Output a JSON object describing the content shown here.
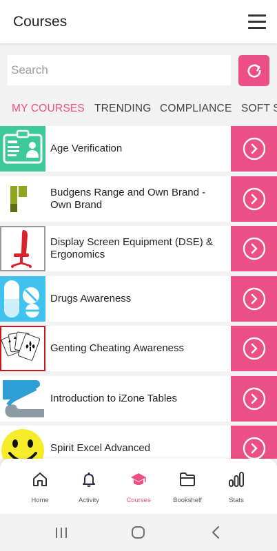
{
  "header": {
    "title": "Courses",
    "menu_icon": "hamburger-menu-icon"
  },
  "search": {
    "placeholder": "Search",
    "value": "",
    "refresh_icon": "refresh-icon"
  },
  "tabs": [
    {
      "label": "MY COURSES",
      "active": true
    },
    {
      "label": "TRENDING",
      "active": false
    },
    {
      "label": "COMPLIANCE",
      "active": false
    },
    {
      "label": "SOFT SKILLS",
      "active": false
    }
  ],
  "courses": [
    {
      "title": "Age Verification",
      "icon": "id-card-icon"
    },
    {
      "title": "Budgens Range and Own Brand - Own Brand",
      "icon": "budgens-logo-icon"
    },
    {
      "title": "Display Screen Equipment (DSE) & Ergonomics",
      "icon": "office-chair-icon"
    },
    {
      "title": "Drugs Awareness",
      "icon": "pills-icon"
    },
    {
      "title": "Genting Cheating Awareness",
      "icon": "playing-cards-icon"
    },
    {
      "title": "Introduction to iZone Tables",
      "icon": "izone-logo-icon"
    },
    {
      "title": "Spirit Excel Advanced",
      "icon": "smiley-face-icon"
    }
  ],
  "nav": [
    {
      "label": "Home",
      "icon": "home-icon",
      "active": false
    },
    {
      "label": "Activity",
      "icon": "bell-icon",
      "active": false
    },
    {
      "label": "Courses",
      "icon": "graduation-cap-icon",
      "active": true
    },
    {
      "label": "Bookshelf",
      "icon": "folder-icon",
      "active": false
    },
    {
      "label": "Stats",
      "icon": "bar-chart-icon",
      "active": false
    }
  ],
  "colors": {
    "accent": "#ec4f85",
    "header_bg": "#ffffff",
    "page_bg": "#f2f2f2",
    "nav_inactive": "#333333"
  }
}
